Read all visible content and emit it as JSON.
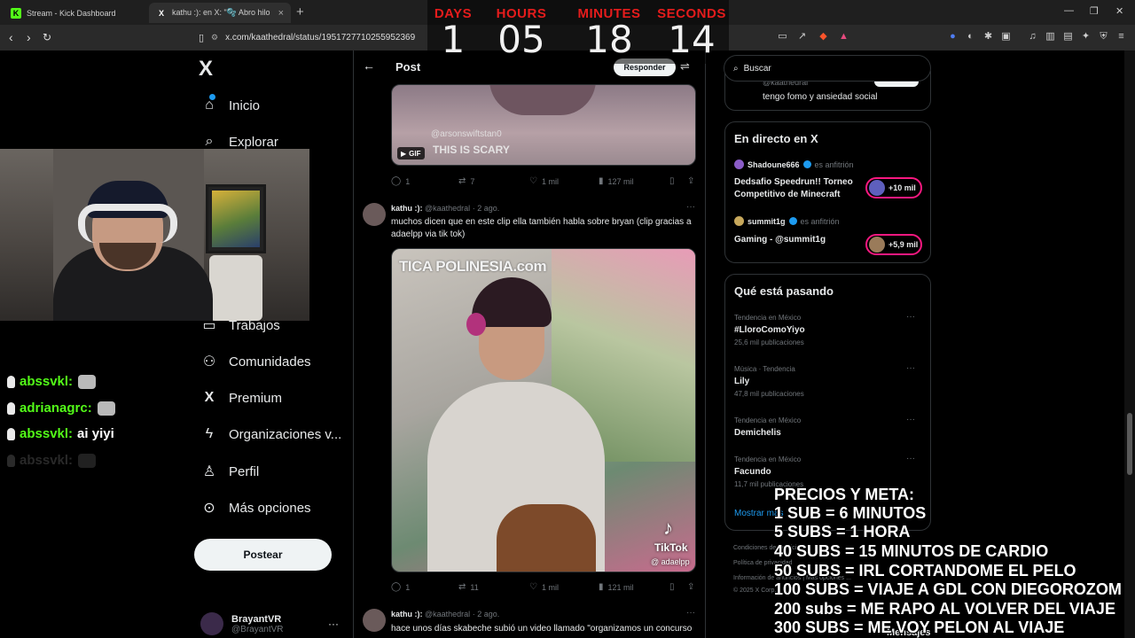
{
  "browser": {
    "tabs": [
      {
        "label": "Stream - Kick Dashboard",
        "favicon": "K",
        "active": false
      },
      {
        "label": "kathu :): en X: \"🫧 Abro hilo",
        "favicon": "X",
        "active": true
      }
    ],
    "url": "x.com/kaathedral/status/1951727710255952369"
  },
  "countdown": {
    "days": {
      "label": "DAYS",
      "value": "1"
    },
    "hours": {
      "label": "HOURS",
      "value": "05"
    },
    "minutes": {
      "label": "MINUTES",
      "value": "18"
    },
    "seconds": {
      "label": "SECONDS",
      "value": "14"
    }
  },
  "nav": {
    "logo": "X",
    "items": [
      {
        "label": "Inicio",
        "icon": "home-icon"
      },
      {
        "label": "Explorar",
        "icon": "search-icon"
      },
      {
        "label": "Trabajos",
        "icon": "briefcase-icon"
      },
      {
        "label": "Comunidades",
        "icon": "people-icon"
      },
      {
        "label": "Premium",
        "icon": "x-icon"
      },
      {
        "label": "Organizaciones v...",
        "icon": "lightning-icon"
      },
      {
        "label": "Perfil",
        "icon": "person-icon"
      },
      {
        "label": "Más opciones",
        "icon": "more-circle-icon"
      }
    ],
    "post_button": "Postear",
    "account": {
      "name": "BrayantVR",
      "handle": "@BrayantVR"
    }
  },
  "chat": [
    {
      "user": "abssvkl:",
      "message": "",
      "emote": true
    },
    {
      "user": "adrianagrc:",
      "message": "",
      "emote": true
    },
    {
      "user": "abssvkl:",
      "message": "ai yiyi",
      "emote": false
    },
    {
      "user": "abssvkl:",
      "message": "",
      "emote": true
    }
  ],
  "timeline": {
    "title": "Post",
    "reply_button": "Responder",
    "gif_tweet": {
      "media_handle": "@arsonswiftstan0",
      "media_caption": "THIS IS SCARY",
      "gif_badge": "GIF",
      "replies": "1",
      "reposts": "7",
      "likes": "1 mil",
      "views": "127 mil"
    },
    "tweet2": {
      "name": "kathu :):",
      "handle": "@kaathedral",
      "date": "· 2 ago.",
      "text": "muchos dicen que en este clip ella también habla sobre bryan (clip gracias a adaelpp via tik tok)",
      "media_sign": "TICA POLINESIA.com",
      "tiktok_label": "TikTok",
      "tiktok_handle": "@ adaelpp",
      "replies": "1",
      "reposts": "11",
      "likes": "1 mil",
      "views": "121 mil"
    },
    "tweet3": {
      "name": "kathu :):",
      "handle": "@kaathedral",
      "date": "· 2 ago.",
      "text": "hace unos días skabeche subió un video llamado \"organizamos un concurso"
    }
  },
  "sidebar": {
    "search_placeholder": "Buscar",
    "top_card": {
      "subtitle": "@kaathedral",
      "text": "tengo fomo y ansiedad social"
    },
    "live": {
      "title": "En directo en X",
      "entries": [
        {
          "host": "Shadoune666",
          "role": "es anfitrión",
          "title": "Dedsafio Speedrun!! Torneo Competitivo de Minecraft",
          "count": "+10 mil"
        },
        {
          "host": "summit1g",
          "role": "es anfitrión",
          "title": "Gaming - @summit1g",
          "count": "+5,9 mil"
        }
      ]
    },
    "trends": {
      "title": "Qué está pasando",
      "items": [
        {
          "meta": "Tendencia en México",
          "name": "#LloroComoYiyo",
          "count": "25,6 mil publicaciones"
        },
        {
          "meta": "Música · Tendencia",
          "name": "Lily",
          "count": "47,8 mil publicaciones"
        },
        {
          "meta": "Tendencia en México",
          "name": "Demichelis",
          "count": ""
        },
        {
          "meta": "Tendencia en México",
          "name": "Facundo",
          "count": "11,7 mil publicaciones"
        }
      ],
      "show_more": "Mostrar más"
    },
    "footer": [
      "Condiciones de Servicio",
      "Política de privacidad",
      "Información de anuncios  |  Más opciones ...",
      "© 2025 X Corp."
    ]
  },
  "prices": {
    "lines": [
      "PRECIOS Y META:",
      "1 SUB = 6 MINUTOS",
      "5 SUBS = 1 HORA",
      "40 SUBS = 15 MINUTOS DE CARDIO",
      "50 SUBS =  IRL CORTANDOME EL PELO",
      "100 SUBS = VIAJE A GDL CON DIEGOROZOM",
      "200 subs = ME RAPO AL VOLVER DEL VIAJE",
      "300 SUBS = ME VOY PELON AL VIAJE"
    ],
    "messages_peek": "Mensajes"
  }
}
